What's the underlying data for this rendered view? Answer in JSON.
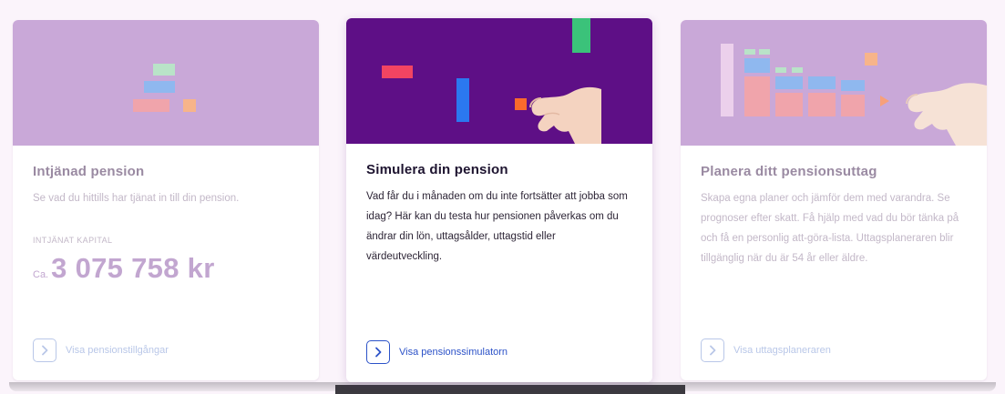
{
  "colors": {
    "page_bg": "#fbf4fb",
    "lavender_banner": "#c9a8d8",
    "purple_banner": "#5e0f86",
    "link_blue": "#2c52c8",
    "muted_link_blue": "#b9c7e8"
  },
  "cards": [
    {
      "title": "Intjänad pension",
      "description": "Se vad du hittills har tjänat in till din pension.",
      "capital_label": "INTJÄNAT KAPITAL",
      "capital_prefix": "Ca.",
      "capital_value": "3 075 758 kr",
      "link_label": "Visa pensionstillgångar",
      "link_icon": "chevron-right-icon",
      "state": "dimmed"
    },
    {
      "title": "Simulera din pension",
      "description": "Vad får du i månaden om du inte fortsätter att jobba som idag? Här kan du testa hur pensionen påverkas om du ändrar din lön, uttagsålder, uttagstid eller värdeutveckling.",
      "link_label": "Visa pensionssimulatorn",
      "link_icon": "chevron-right-icon",
      "state": "active"
    },
    {
      "title": "Planera ditt pensionsuttag",
      "description": "Skapa egna planer och jämför dem med varandra. Se prognoser efter skatt. Få hjälp med vad du bör tänka på och få en personlig att-göra-lista. Uttagsplaneraren blir tillgänglig när du är 54 år eller äldre.",
      "link_label": "Visa uttagsplaneraren",
      "link_icon": "chevron-right-icon",
      "state": "dimmed"
    }
  ]
}
